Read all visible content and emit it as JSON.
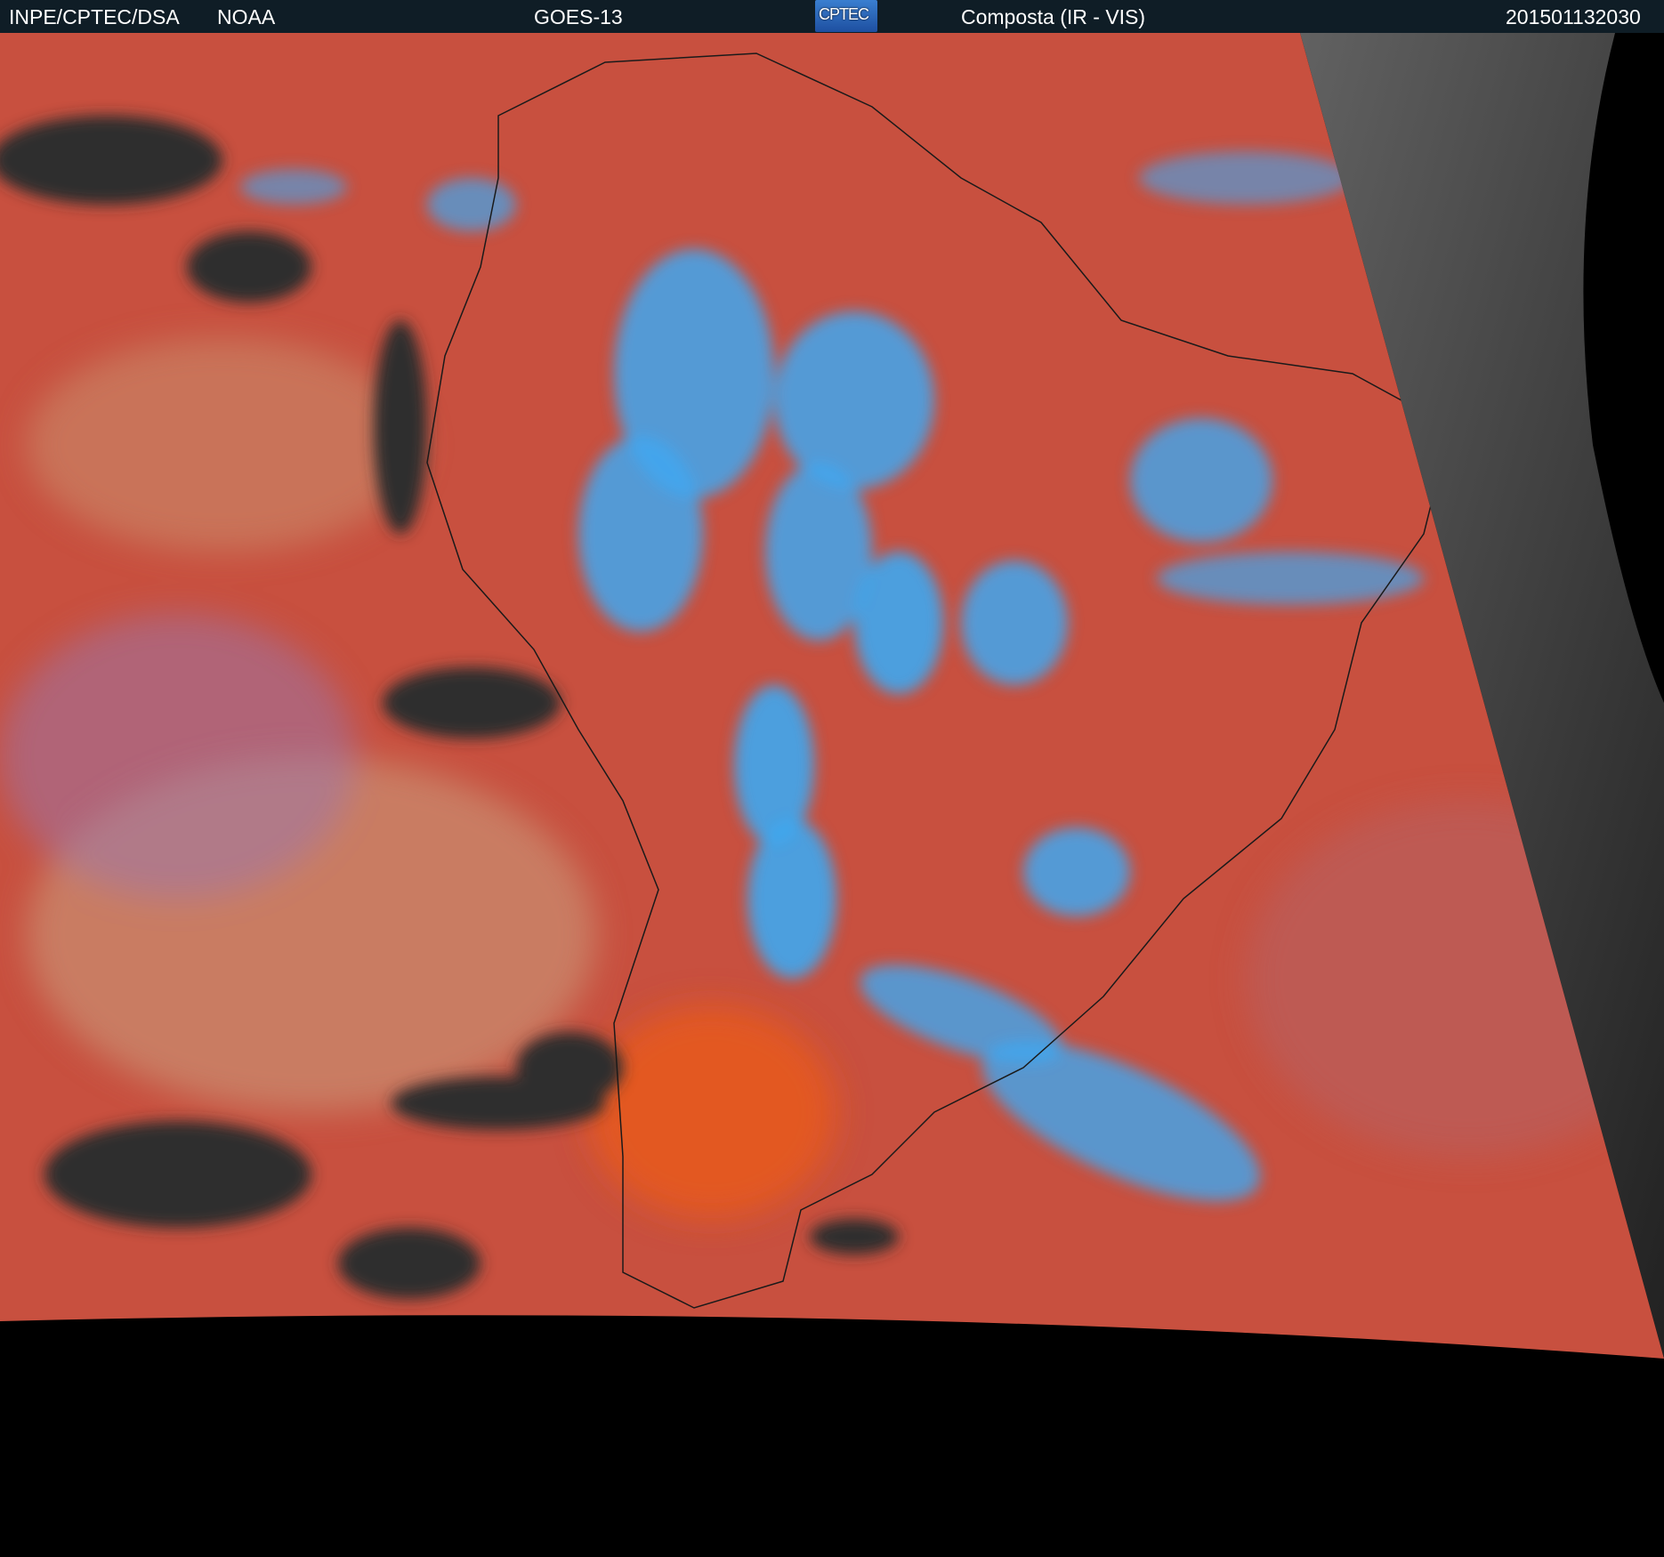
{
  "header": {
    "agency": "INPE/CPTEC/DSA",
    "provider": "NOAA",
    "satellite": "GOES-13",
    "logo_text": "CPTEC",
    "product": "Composta (IR - VIS)",
    "timestamp": "201501132030"
  },
  "colors": {
    "header_bg": "#0f1d26",
    "land_ocean_red": "#c8503f",
    "high_cloud_blue": "#3fa7f0",
    "clear_dark": "#2e2e2e",
    "outside_disk": "#000000"
  }
}
